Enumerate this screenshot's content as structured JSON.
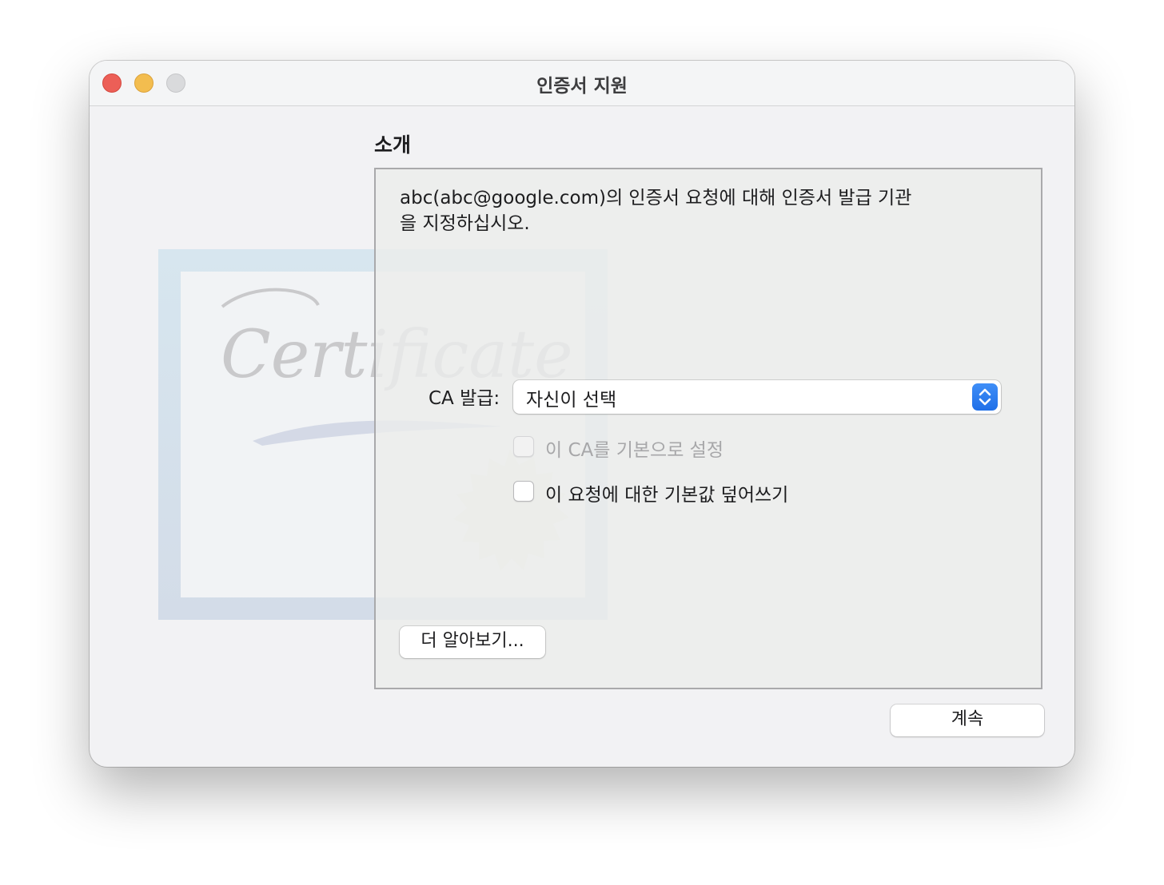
{
  "window": {
    "title": "인증서 지원"
  },
  "section": {
    "title": "소개"
  },
  "illustration": {
    "watermark_text": "Certificate"
  },
  "form": {
    "description": "abc(abc@google.com)의 인증서 요청에 대해 인증서 발급 기관을 지정하십시오.",
    "ca_label": "CA 발급:",
    "ca_selected": "자신이 선택",
    "default_ca_checkbox": {
      "label": "이 CA를 기본으로 설정",
      "checked": false,
      "enabled": false
    },
    "override_checkbox": {
      "label": "이 요청에 대한 기본값 덮어쓰기",
      "checked": false,
      "enabled": true
    },
    "learn_more_label": "더 알아보기..."
  },
  "footer": {
    "continue_label": "계속"
  },
  "colors": {
    "close": "#ec5f57",
    "minimize": "#f3bd4f",
    "zoom": "#d9dadc",
    "accent": "#1f6fe8"
  }
}
